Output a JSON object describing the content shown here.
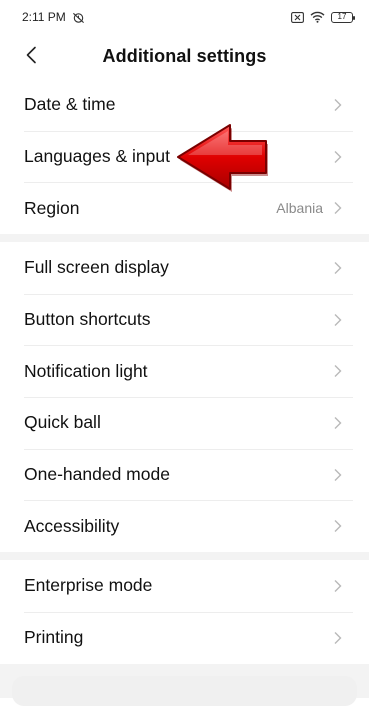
{
  "status_bar": {
    "time": "2:11 PM",
    "battery": "17",
    "icons": [
      "alarm-off-icon",
      "sim-none-icon",
      "wifi-icon",
      "battery-icon"
    ]
  },
  "header": {
    "title": "Additional settings",
    "back_icon": "chevron-left-icon"
  },
  "sections": [
    {
      "items": [
        {
          "label": "Date & time"
        },
        {
          "label": "Languages & input"
        },
        {
          "label": "Region",
          "value": "Albania"
        }
      ]
    },
    {
      "items": [
        {
          "label": "Full screen display"
        },
        {
          "label": "Button shortcuts"
        },
        {
          "label": "Notification light"
        },
        {
          "label": "Quick ball"
        },
        {
          "label": "One-handed mode"
        },
        {
          "label": "Accessibility"
        }
      ]
    },
    {
      "items": [
        {
          "label": "Enterprise mode"
        },
        {
          "label": "Printing"
        }
      ]
    }
  ],
  "annotation": {
    "icon": "red-arrow-icon",
    "color": "#d40000",
    "points_to": "Languages & input"
  },
  "colors": {
    "background": "#ffffff",
    "section_divider": "#f3f3f3",
    "chevron": "#b8b8b8",
    "value_text": "#8a8a8a"
  }
}
